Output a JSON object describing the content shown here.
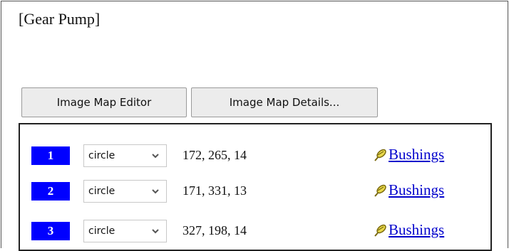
{
  "page": {
    "title": "[Gear Pump]"
  },
  "toolbar": {
    "editor_label": "Image Map Editor",
    "details_label": "Image Map Details..."
  },
  "areas": [
    {
      "number": "1",
      "shape": "circle",
      "coords": "172, 265, 14",
      "link": "Bushings"
    },
    {
      "number": "2",
      "shape": "circle",
      "coords": "171, 331, 13",
      "link": "Bushings"
    },
    {
      "number": "3",
      "shape": "circle",
      "coords": "327, 198, 14",
      "link": "Bushings"
    }
  ],
  "icons": {
    "shape_dropdown": "chevron-down-icon",
    "link": "pin-icon"
  },
  "colors": {
    "number_badge_bg": "#0000ff",
    "link": "#0000cc"
  }
}
